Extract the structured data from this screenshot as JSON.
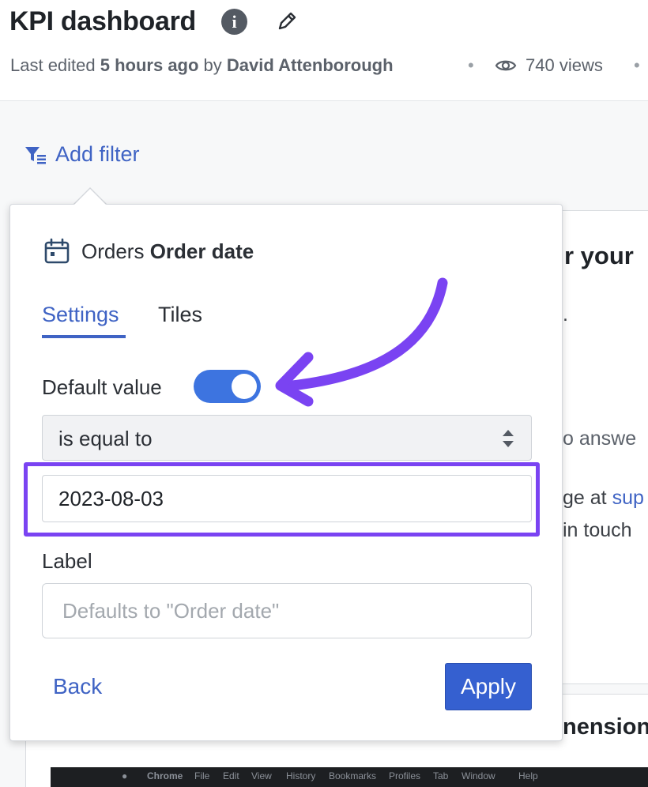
{
  "header": {
    "title": "KPI dashboard",
    "info_icon_glyph": "i",
    "meta_prefix": "Last edited ",
    "meta_time": "5 hours ago",
    "meta_by": " by ",
    "meta_author": "David Attenborough",
    "separator": "•",
    "views": "740 views"
  },
  "toolbar": {
    "add_filter_label": "Add filter"
  },
  "background": {
    "heading_fragment": "r your",
    "line1": ".",
    "line2": "o answe",
    "line3_text": "ge at ",
    "line3_link": "sup",
    "line4": "in touch",
    "heading2_fragment": "nension",
    "chrome_menu": [
      "Chrome",
      "File",
      "Edit",
      "View",
      "History",
      "Bookmarks",
      "Profiles",
      "Tab",
      "Window",
      "Help"
    ]
  },
  "popover": {
    "field_table": "Orders",
    "field_name": "Order date",
    "tabs": [
      {
        "label": "Settings",
        "active": true
      },
      {
        "label": "Tiles",
        "active": false
      }
    ],
    "default_value_label": "Default value",
    "default_value_enabled": true,
    "operator": "is equal to",
    "date_value": "2023-08-03",
    "label_title": "Label",
    "label_placeholder": "Defaults to \"Order date\"",
    "back_label": "Back",
    "apply_label": "Apply"
  },
  "colors": {
    "accent": "#3f63c4",
    "toggle": "#3d74e0",
    "annotation": "#7a43f2"
  },
  "icons": [
    "info-icon",
    "pencil-icon",
    "eye-icon",
    "filter-icon",
    "calendar-icon",
    "select-arrows-icon",
    "annotation-arrow"
  ]
}
